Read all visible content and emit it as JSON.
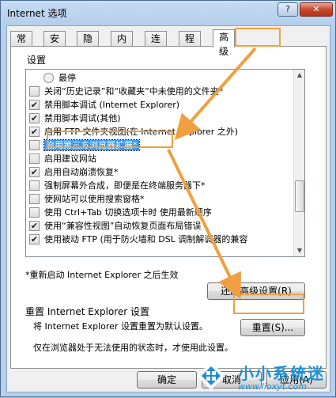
{
  "window": {
    "title": "Internet 选项",
    "help_label": "?",
    "close_label": "✕"
  },
  "tabs": [
    {
      "label": "常规"
    },
    {
      "label": "安全"
    },
    {
      "label": "隐私"
    },
    {
      "label": "内容"
    },
    {
      "label": "连接"
    },
    {
      "label": "程序"
    },
    {
      "label": "高级",
      "active": true
    }
  ],
  "settings": {
    "heading": "设置",
    "items": [
      {
        "type": "radio",
        "label": "最停",
        "checked": false
      },
      {
        "type": "checkbox",
        "label": "关闭“历史记录”和“收藏夹”中未使用的文件夹*",
        "checked": false
      },
      {
        "type": "checkbox",
        "label": "禁用脚本调试 (Internet Explorer)",
        "checked": true
      },
      {
        "type": "checkbox",
        "label": "禁用脚本调试(其他)",
        "checked": true
      },
      {
        "type": "checkbox",
        "label": "启用 FTP 文件夹视图(在 Internet Explorer 之外)",
        "checked": true
      },
      {
        "type": "checkbox",
        "label": "启用第三方浏览器扩展*",
        "checked": false,
        "selected": true
      },
      {
        "type": "checkbox",
        "label": "启用建议网站",
        "checked": false
      },
      {
        "type": "checkbox",
        "label": "启用自动崩溃恢复*",
        "checked": true
      },
      {
        "type": "checkbox",
        "label": "强制屏幕外合成，即便是在终端服务器下*",
        "checked": false
      },
      {
        "type": "checkbox",
        "label": "使网站可以使用搜索窗格*",
        "checked": false
      },
      {
        "type": "checkbox",
        "label": "使用 Ctrl+Tab 切换选项卡时 使用最新顺序",
        "checked": false
      },
      {
        "type": "checkbox",
        "label": "使用“兼容性视图”自动恢复页面布局错误",
        "checked": true
      },
      {
        "type": "checkbox",
        "label": "使用被动 FTP (用于防火墙和 DSL 调制解调器的兼容",
        "checked": true
      }
    ],
    "restart_note": "*重新启动 Internet Explorer 之后生效",
    "restore_button": "还原高级设置(R)"
  },
  "reset": {
    "heading": "重置 Internet Explorer 设置",
    "description": "将 Internet Explorer 设置重置为默认设置。",
    "button": "重置(S)...",
    "note": "仅在浏览器处于无法使用的状态时，才使用此设置。"
  },
  "footer": {
    "ok": "确定",
    "cancel": "取消",
    "apply": "应用(A)"
  },
  "watermark": {
    "text": "小小系统迷",
    "url": "www.lioxyt.com"
  },
  "colors": {
    "annotation": "#f0a040",
    "selection": "#3399ff",
    "watermark": "#1a8fd6"
  }
}
